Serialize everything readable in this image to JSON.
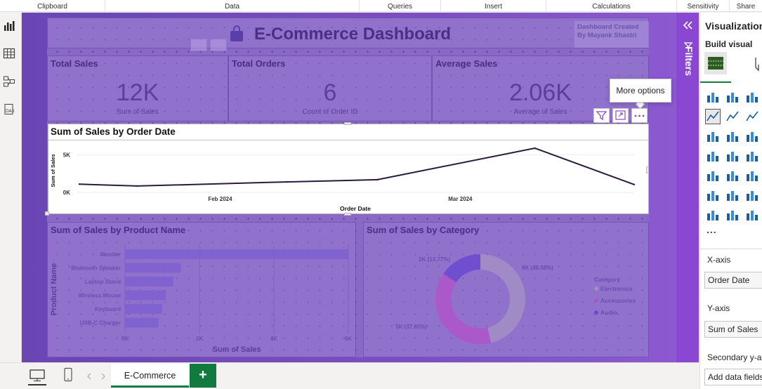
{
  "ribbon": {
    "groups": [
      "Clipboard",
      "Data",
      "Queries",
      "Insert",
      "Calculations",
      "Sensitivity",
      "Share"
    ]
  },
  "dashboard": {
    "title": "E-Commerce Dashboard",
    "credit_line1": "Dashboard Created",
    "credit_line2": "By Mayank Shastri"
  },
  "kpis": [
    {
      "label": "Total Sales",
      "value": "12K",
      "sub": "Sum of Sales"
    },
    {
      "label": "Total Orders",
      "value": "6",
      "sub": "Count of Order ID"
    },
    {
      "label": "Average Sales",
      "value": "2.06K",
      "sub": "Average of Sales"
    }
  ],
  "tooltip": {
    "text": "More options"
  },
  "chart_data": [
    {
      "type": "line",
      "title": "Sum of Sales by Order Date",
      "xlabel": "Order Date",
      "ylabel": "Sum of Sales",
      "x_tick_labels": [
        "Feb 2024",
        "Mar 2024"
      ],
      "y_tick_labels": [
        "5K",
        "0K"
      ],
      "ylim": [
        0,
        6000
      ],
      "series": [
        {
          "x": [
            "2024-01-15",
            "2024-01-22",
            "2024-02-09",
            "2024-02-20",
            "2024-03-10",
            "2024-03-22"
          ],
          "values": [
            1100,
            850,
            1400,
            1700,
            5900,
            1050
          ]
        }
      ],
      "color": "#2b1a3a"
    },
    {
      "type": "bar",
      "orientation": "horizontal",
      "title": "Sum of Sales by Product Name",
      "xlabel": "Sum of Sales",
      "ylabel": "Product Name",
      "categories": [
        "Monitor",
        "Bluetooth Speaker",
        "Laptop Stand",
        "Wireless Mouse",
        "Keyboard",
        "USB-C Charger"
      ],
      "values": [
        6000,
        1500,
        1300,
        1100,
        1000,
        900
      ],
      "x_tick_labels": [
        "0K",
        "2K",
        "4K",
        "6K"
      ],
      "xlim": [
        0,
        6000
      ]
    },
    {
      "type": "pie",
      "donut": true,
      "title": "Sum of Sales by Category",
      "legend_title": "Category",
      "legend_position": "right",
      "slices": [
        {
          "label": "Electronics",
          "value": 6000,
          "data_label": "6K (48.58%)",
          "color": "#a48fc4"
        },
        {
          "label": "Accessories",
          "value": 5000,
          "data_label": "5K (37.65%)",
          "color": "#b055c9"
        },
        {
          "label": "Audio",
          "value": 2000,
          "data_label": "2K (13.77%)",
          "color": "#6a48d0"
        }
      ]
    }
  ],
  "filters": {
    "label": "Filters"
  },
  "viz_pane": {
    "title": "Visualizations",
    "build_visual": "Build visual",
    "more": "...",
    "xaxis_label": "X-axis",
    "xaxis_value": "Order Date",
    "yaxis_label": "Y-axis",
    "yaxis_value": "Sum of Sales",
    "secondary_label": "Secondary y-axis",
    "add_field": "Add data fields here"
  },
  "bottom": {
    "tab": "E-Commerce",
    "add": "+"
  }
}
